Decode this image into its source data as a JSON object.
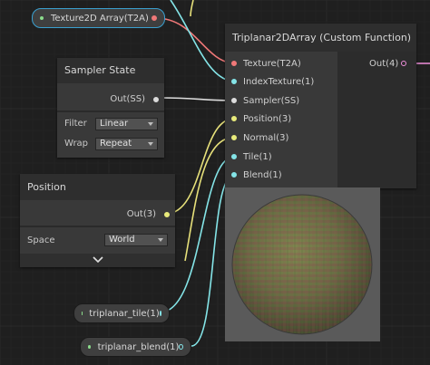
{
  "colors": {
    "background": "#1f1f1f",
    "texture_port": "#f07878",
    "vector_port": "#84e4e7",
    "sampler_port": "#ffffff",
    "vector3_port": "#e8ea7b",
    "vector1_port": "#84e4e7",
    "property_dot": "#8bdc8b",
    "selection": "#3aa0d0"
  },
  "property_texture": {
    "label": "Texture2D Array(T2A)",
    "icon": "green-dot-icon",
    "port_icon": "texture-port-icon"
  },
  "sampler_node": {
    "title": "Sampler State",
    "output_label": "Out(SS)",
    "filter_label": "Filter",
    "filter_value": "Linear",
    "wrap_label": "Wrap",
    "wrap_value": "Repeat"
  },
  "position_node": {
    "title": "Position",
    "output_label": "Out(3)",
    "space_label": "Space",
    "space_value": "World",
    "collapse_icon": "chevron-down-icon"
  },
  "triplanar_node": {
    "title": "Triplanar2DArray (Custom Function)",
    "output_label": "Out(4)",
    "inputs": [
      {
        "label": "Texture(T2A)"
      },
      {
        "label": "IndexTexture(1)"
      },
      {
        "label": "Sampler(SS)"
      },
      {
        "label": "Position(3)"
      },
      {
        "label": "Normal(3)"
      },
      {
        "label": "Tile(1)"
      },
      {
        "label": "Blend(1)"
      }
    ]
  },
  "property_tile": {
    "label": "triplanar_tile(1)"
  },
  "property_blend": {
    "label": "triplanar_blend(1)"
  }
}
